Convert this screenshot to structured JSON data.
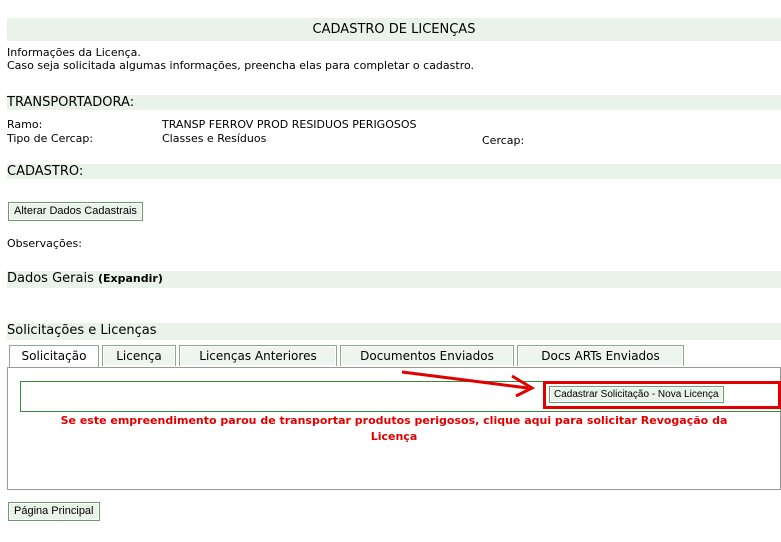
{
  "title": "CADASTRO DE LICENÇAS",
  "intro": {
    "line1": "Informações da Licença.",
    "line2": "Caso seja solicitada algumas informações, preencha elas para completar o cadastro."
  },
  "transportadora": {
    "heading": "TRANSPORTADORA:",
    "ramo_label": "Ramo:",
    "ramo_value": "TRANSP FERROV PROD RESIDUOS PERIGOSOS",
    "tipo_label": "Tipo de Cercap:",
    "tipo_value": "Classes e Resíduos",
    "cercap_label": "Cercap:"
  },
  "cadastro": {
    "heading": "CADASTRO:",
    "alterar_button": "Alterar Dados Cadastrais",
    "observacoes_label": "Observações:"
  },
  "dados_gerais": {
    "heading": "Dados Gerais",
    "expand_link": "(Expandir)"
  },
  "solicitacoes": {
    "heading": "Solicitações e Licenças",
    "tabs": [
      "Solicitação",
      "Licença",
      "Licenças Anteriores",
      "Documentos Enviados",
      "Docs ARTs Enviados"
    ],
    "active_tab": "Solicitação",
    "cadastrar_button": "Cadastrar Solicitação - Nova Licença",
    "warning_line1": "Se este empreendimento parou de transportar produtos perigosos, clique aqui para solicitar Revogação da",
    "warning_line2": "Licença"
  },
  "footer": {
    "pagina_button": "Página Principal"
  },
  "colors": {
    "band": "#eaf3ea",
    "highlight": "#e00000",
    "warning_text": "#e00000"
  }
}
